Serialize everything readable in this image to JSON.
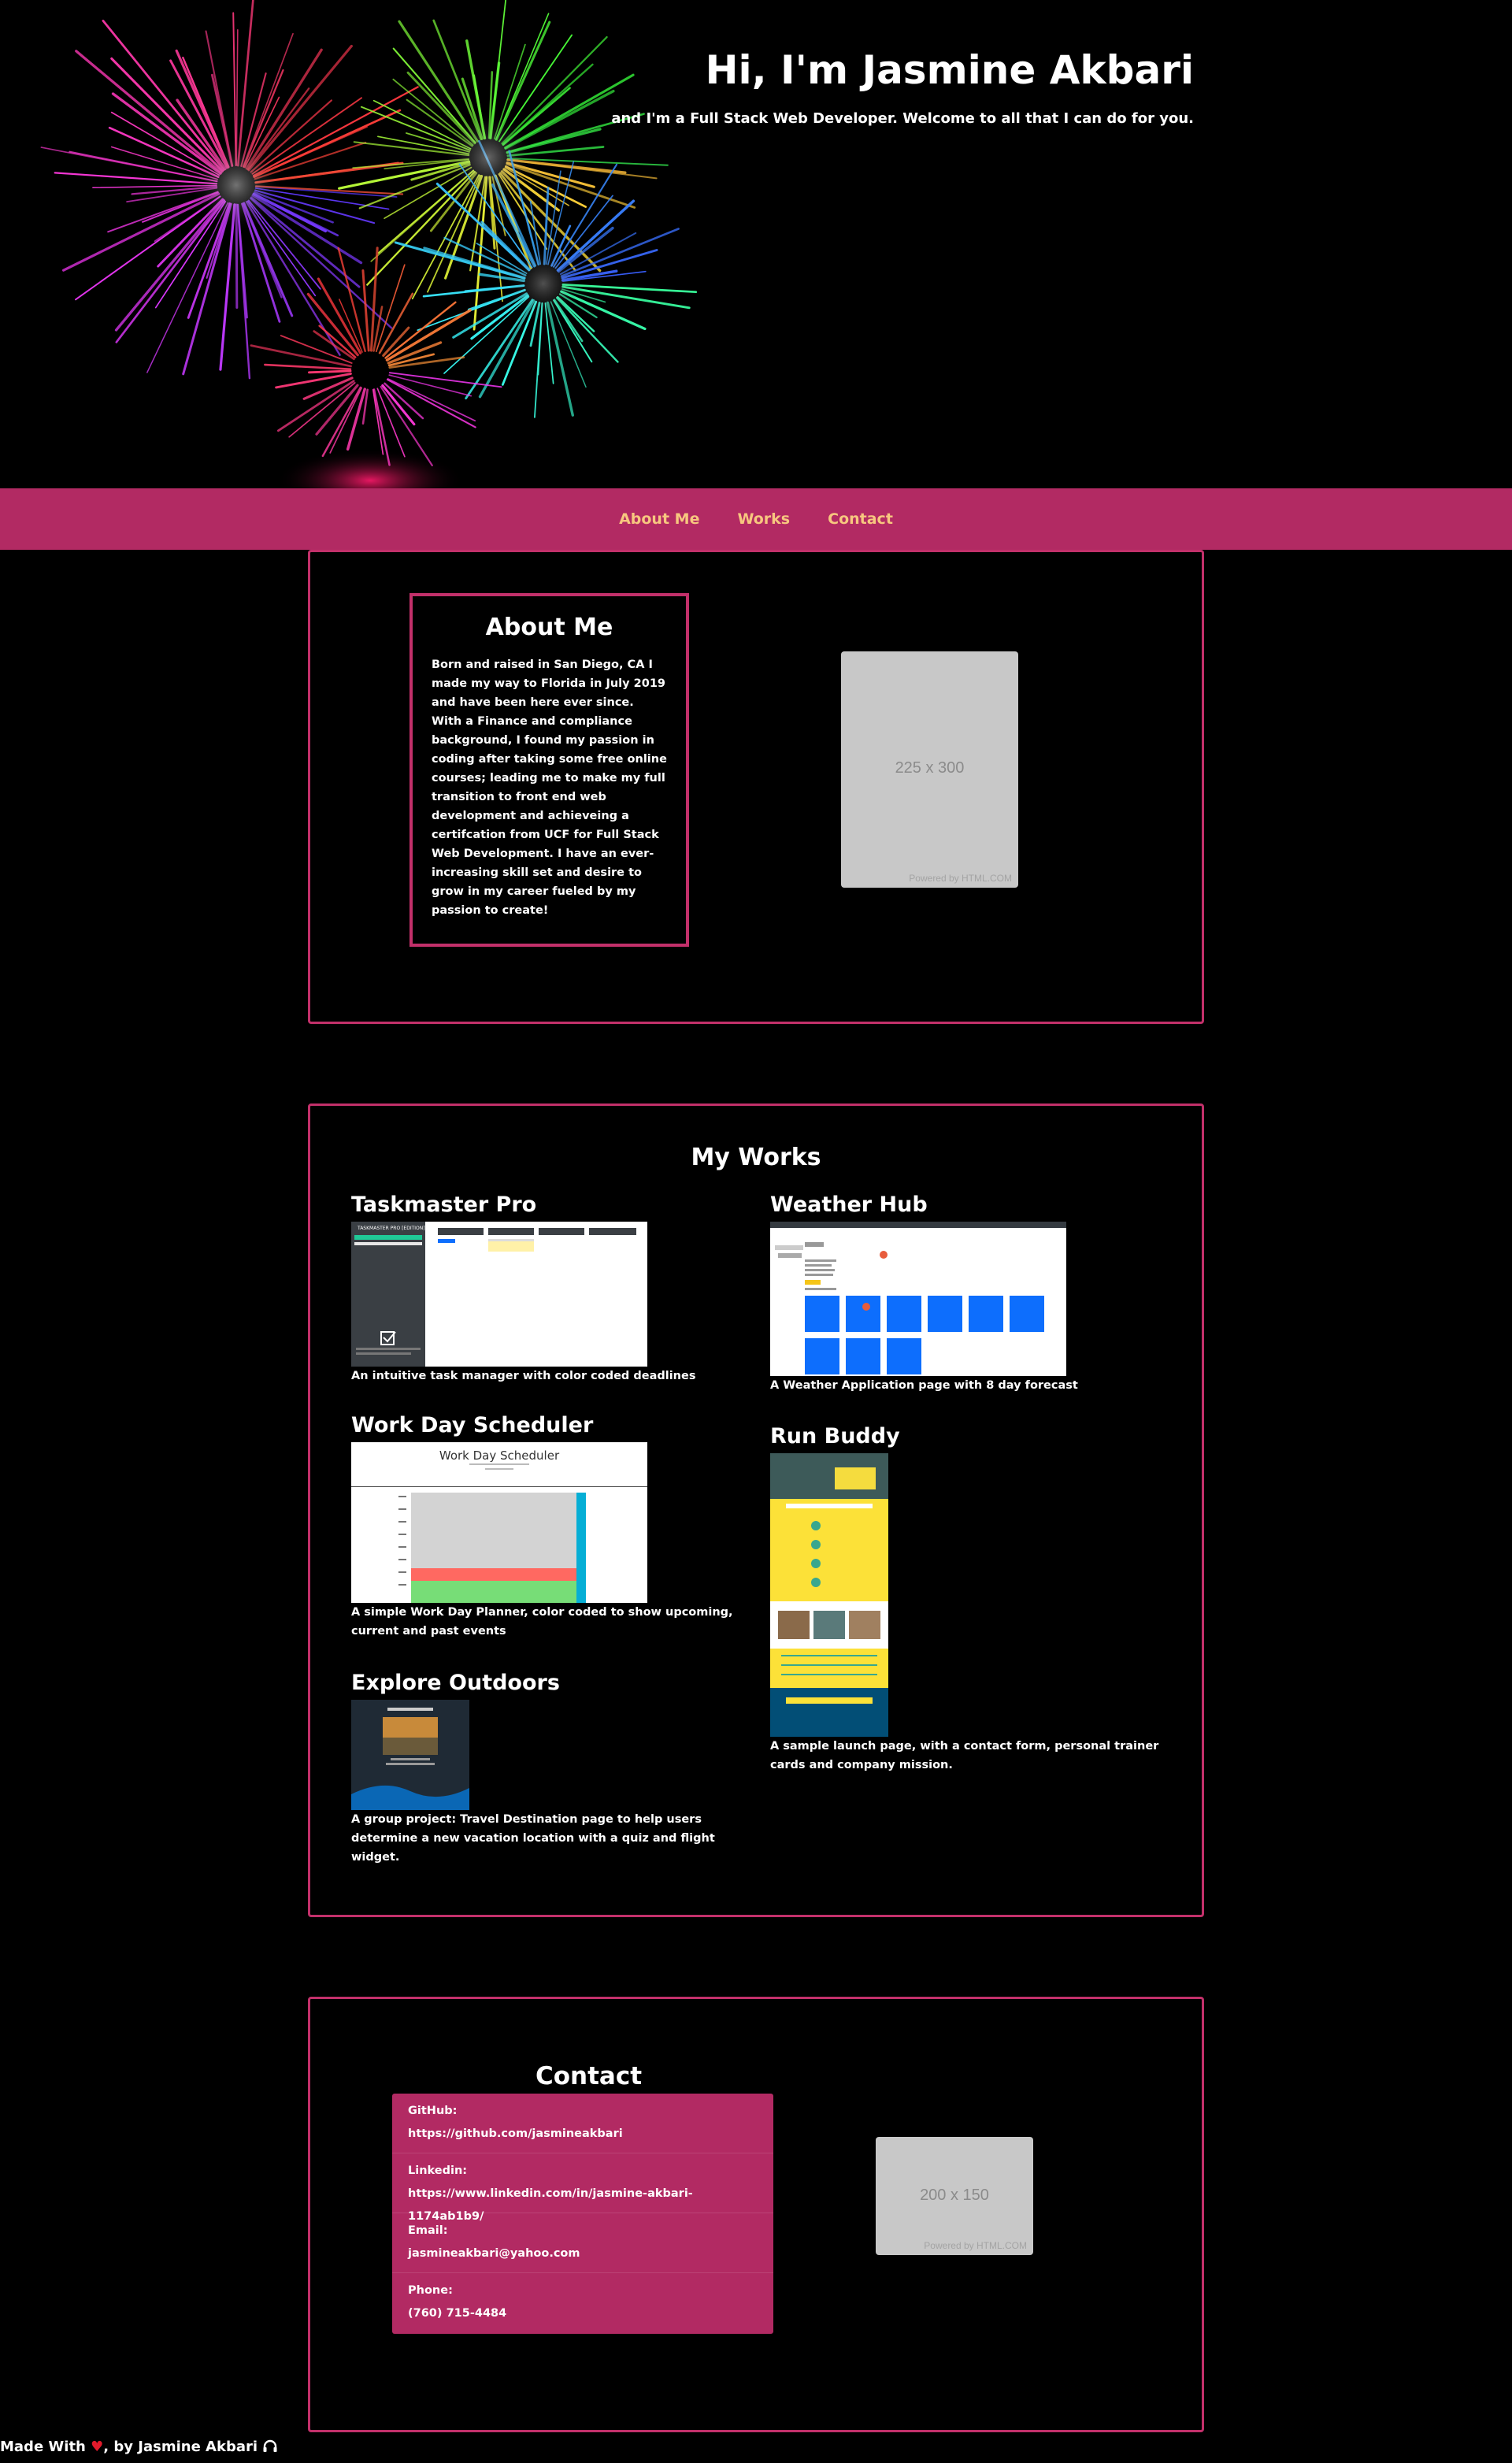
{
  "hero": {
    "title": "Hi, I'm Jasmine Akbari",
    "subtitle": "and I'm a Full Stack Web Developer. Welcome to all that I can do for you.",
    "background_icon": "fireworks-image"
  },
  "nav": {
    "items": [
      {
        "label": "About Me"
      },
      {
        "label": "Works"
      },
      {
        "label": "Contact"
      }
    ]
  },
  "about": {
    "heading": "About Me",
    "text": "Born and raised in San Diego, CA I made my way to Florida in July 2019 and have been here ever since. With a Finance and compliance background, I found my passion in coding after taking some free online courses; leading me to make my full transition to front end web development and achieveing a certifcation from UCF for Full Stack Web Development. I have an ever-increasing skill set and desire to grow in my career fueled by my passion to create!",
    "image": {
      "size_label": "225 x 300",
      "credit": "Powered by HTML.COM"
    }
  },
  "works": {
    "heading": "My Works",
    "items": [
      {
        "title": "Taskmaster Pro",
        "description": "An intuitive task manager with color coded deadlines",
        "screenshot_header": "TASKMASTER PRO [EDITION]"
      },
      {
        "title": "Weather Hub",
        "description": "A Weather Application page with 8 day forecast"
      },
      {
        "title": "Work Day Scheduler",
        "description": "A simple Work Day Planner, color coded to show upcoming, current and past events",
        "screenshot_header": "Work Day Scheduler"
      },
      {
        "title": "Run Buddy",
        "description": "A sample launch page, with a contact form, personal trainer cards and company mission."
      },
      {
        "title": "Explore Outdoors",
        "description": "A group project: Travel Destination page to help users determine a new vacation location with a quiz and flight widget."
      }
    ]
  },
  "contact": {
    "heading": "Contact",
    "items": [
      {
        "label": "GitHub:",
        "value": "https://github.com/jasmineakbari"
      },
      {
        "label": "Linkedin:",
        "value": "https://www.linkedin.com/in/jasmine-akbari-1174ab1b9/"
      },
      {
        "label": "Email:",
        "value": "jasmineakbari@yahoo.com"
      },
      {
        "label": "Phone:",
        "value": "(760) 715-4484"
      }
    ],
    "image": {
      "size_label": "200 x 150",
      "credit": "Powered by HTML.COM"
    }
  },
  "footer": {
    "prefix": "Made With",
    "suffix": ", by Jasmine Akbari",
    "icons": [
      "heart-icon",
      "headphones-icon"
    ]
  },
  "colors": {
    "background": "#000000",
    "accent": "#b22a63",
    "nav_text": "#f7c77f",
    "border": "#c2306a",
    "placeholder": "#c8c8c8"
  }
}
